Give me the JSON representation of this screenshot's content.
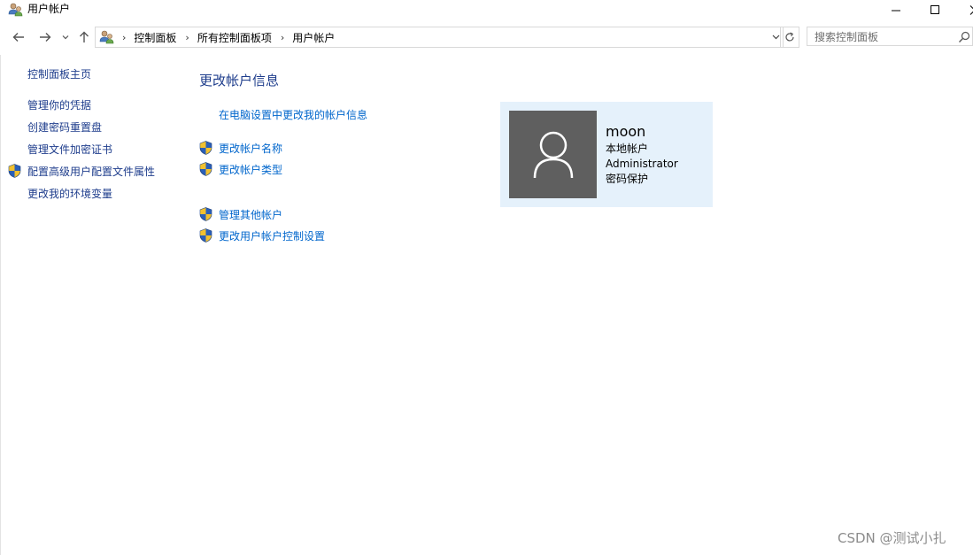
{
  "window": {
    "title": "用户帐户",
    "minimize_icon": "minimize-icon",
    "maximize_icon": "maximize-icon",
    "close_icon": "close-icon"
  },
  "navigation": {
    "back_icon": "arrow-left-icon",
    "forward_icon": "arrow-right-icon",
    "recent_icon": "chevron-down-icon",
    "up_icon": "arrow-up-icon",
    "breadcrumbs": [
      "控制面板",
      "所有控制面板项",
      "用户帐户"
    ],
    "refresh_icon": "refresh-icon",
    "search_placeholder": "搜索控制面板",
    "search_value": ""
  },
  "sidebar": {
    "items": [
      {
        "label": "控制面板主页",
        "shield": false
      },
      {
        "label": "管理你的凭据",
        "shield": false
      },
      {
        "label": "创建密码重置盘",
        "shield": false
      },
      {
        "label": "管理文件加密证书",
        "shield": false
      },
      {
        "label": "配置高级用户配置文件属性",
        "shield": true
      },
      {
        "label": "更改我的环境变量",
        "shield": false
      }
    ]
  },
  "main": {
    "heading": "更改帐户信息",
    "pc_settings_link": "在电脑设置中更改我的帐户信息",
    "links": [
      {
        "label": "更改帐户名称",
        "shield": true
      },
      {
        "label": "更改帐户类型",
        "shield": true
      },
      {
        "label": "管理其他帐户",
        "shield": true
      },
      {
        "label": "更改用户帐户控制设置",
        "shield": true
      }
    ]
  },
  "account": {
    "name": "moon",
    "type": "本地帐户",
    "group": "Administrator",
    "status": "密码保护",
    "avatar_icon": "user-avatar-icon"
  },
  "watermark": "CSDN @测试小扎",
  "colors": {
    "link": "#0066cc",
    "heading": "#1e3d8c",
    "card_bg": "#e5f1fb",
    "avatar_bg": "#5f5f5f"
  }
}
